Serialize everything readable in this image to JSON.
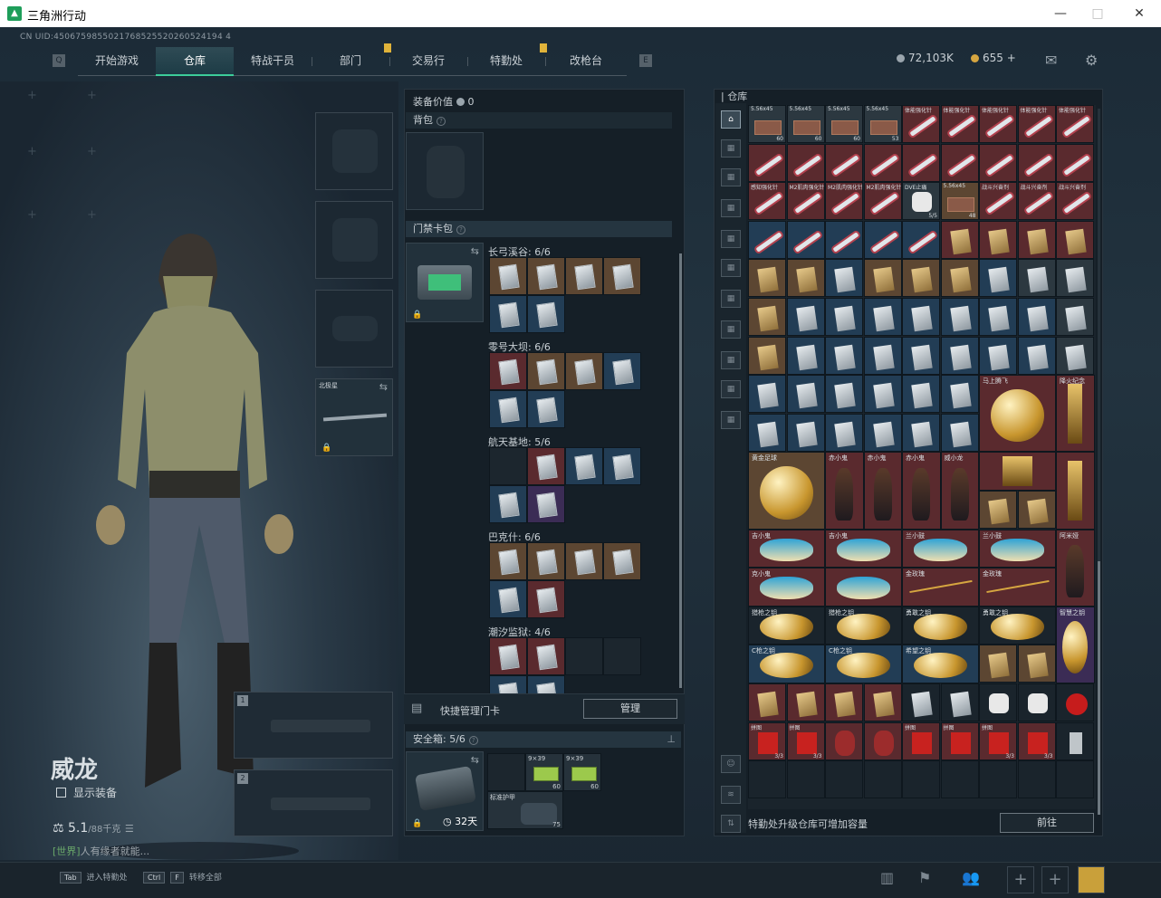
{
  "window": {
    "title": "三角洲行动",
    "min": "—",
    "max": "□",
    "close": "✕"
  },
  "uid": "CN UID:4506759855021768525520260524194 4",
  "nav": {
    "items": [
      {
        "label": "开始游戏"
      },
      {
        "label": "仓库"
      },
      {
        "label": "特战干员"
      },
      {
        "label": "部门"
      },
      {
        "label": "交易行"
      },
      {
        "label": "特勤处"
      },
      {
        "label": "改枪台"
      }
    ],
    "active": "仓库"
  },
  "currency": {
    "hafcoin": "72,103K",
    "coupons": "655",
    "plus": "+"
  },
  "character": {
    "name": "威龙",
    "show_equipment": "显示装备",
    "weight": "5.1",
    "weight_max": "/88千克",
    "chat_channel": "[世界]",
    "chat_msg": "人有缘者就能..."
  },
  "slots": {
    "melee_label": "北极星"
  },
  "middle": {
    "equip_value_label": "装备价值",
    "equip_value": "0",
    "backpack_label": "背包",
    "keycard_label": "门禁卡包",
    "locations": [
      {
        "name": "长弓溪谷: 6/6"
      },
      {
        "name": "零号大坝: 6/6"
      },
      {
        "name": "航天基地: 5/6"
      },
      {
        "name": "巴克什: 6/6"
      },
      {
        "name": "潮汐监狱: 4/6"
      }
    ],
    "quick_manage": "快捷管理门卡",
    "manage_btn": "管理",
    "safe_label": "安全箱: 5/6",
    "safe_days": "32天",
    "safe_items": [
      {
        "label": "9×39",
        "count": "60"
      },
      {
        "label": "9×39",
        "count": "60"
      },
      {
        "label": "标准护甲",
        "count": "75"
      }
    ]
  },
  "warehouse": {
    "title": "仓库",
    "footer": "特勤处升级仓库可增加容量",
    "go_btn": "前往",
    "row_labels": {
      "r0": [
        "5.56x45",
        "5.56x45",
        "5.56x45",
        "5.56x45",
        "体能强化针",
        "体能强化针",
        "体能强化针",
        "体能强化针",
        "体能强化针"
      ],
      "r0cnt": [
        "60",
        "60",
        "60",
        "53",
        "",
        "",
        "",
        "",
        ""
      ],
      "r2": [
        "感知强化针",
        "M2肌肉强化针",
        "M2肌肉强化针",
        "M2肌肉强化针",
        "DVE止痛",
        "5.56x45",
        "战斗兴奋剂",
        "战斗兴奋剂",
        "战斗兴奋剂"
      ],
      "r2cnt": [
        "",
        "",
        "",
        "",
        "5/5",
        "48",
        "",
        "",
        ""
      ],
      "big1": [
        "黄金足球",
        "赤小鬼",
        "赤小鬼",
        "赤小鬼",
        "威小龙"
      ],
      "big2": [
        "吉小鬼",
        "吉小鬼",
        "兰小鼓",
        "兰小鼓",
        "阿米娅"
      ],
      "big3": [
        "克小鬼",
        "",
        "金玫瑰",
        "金玫瑰",
        ""
      ],
      "keys1": [
        "猎枪之钥",
        "猎枪之钥",
        "勇敢之钥",
        "勇敢之钥",
        "智慧之钥"
      ],
      "keys2": [
        "C枪之钥",
        "C枪之钥",
        "希望之钥",
        "",
        "",
        ""
      ],
      "last": [
        "拼图",
        "拼图",
        "",
        "",
        "拼图",
        "拼图",
        "拼图",
        ""
      ],
      "lastcnt": [
        "3/3",
        "3/3",
        "",
        "",
        "",
        "",
        "3/3",
        "3/3"
      ],
      "specials": [
        "马上腾飞",
        "降火纪念"
      ]
    }
  }
}
